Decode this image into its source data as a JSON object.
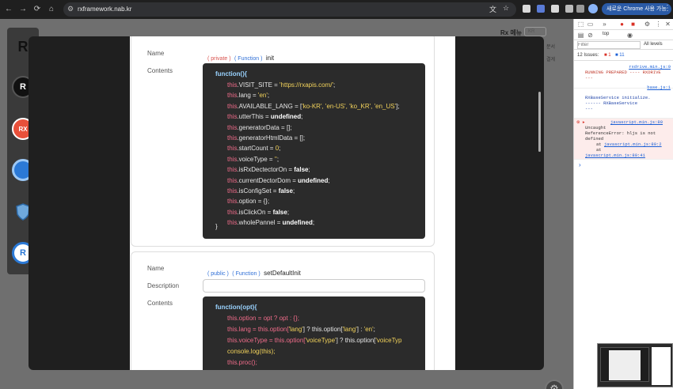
{
  "browser": {
    "url": "rxframework.nab.kr",
    "profile_label": "새로운 Chrome 사용 가능",
    "nav": {
      "back": "←",
      "forward": "→",
      "reload": "⟳",
      "home": "⌂"
    }
  },
  "page": {
    "rx_menu_label": "Rx 메뉴",
    "lang_value": "KR",
    "side_text_1": "분서",
    "side_text_2": "결게"
  },
  "dock": {
    "items": [
      {
        "icon": "rx-logo-icon",
        "text": "R"
      },
      {
        "icon": "rust-logo-icon",
        "text": "R"
      },
      {
        "icon": "rx-html-icon",
        "text": "RX"
      },
      {
        "icon": "blue-circle-icon",
        "text": ""
      },
      {
        "icon": "shield-icon",
        "text": ""
      },
      {
        "icon": "r-circle-icon",
        "text": ""
      }
    ]
  },
  "card1": {
    "name_label": "Name",
    "contents_label": "Contents",
    "access": "( private )",
    "kind": "( Function )",
    "func_name": "init"
  },
  "card2": {
    "name_label": "Name",
    "description_label": "Description",
    "contents_label": "Contents",
    "access": "( public )",
    "kind": "( Function )",
    "func_name": "setDefaultInit"
  },
  "code1": {
    "open": "function(){",
    "close": "}",
    "lines": [
      [
        "this",
        ".VISIT_SITE = ",
        "'https://rxapis.com/'",
        ";"
      ],
      [
        "this",
        ".lang = ",
        "'en'",
        ";"
      ],
      [
        "this",
        ".AVAILABLE_LANG = [",
        "'ko-KR', 'en-US', 'ko_KR', 'en_US'",
        "];"
      ],
      [
        "this",
        ".utterThis = ",
        "undefined",
        ";"
      ],
      [
        "this",
        ".generatorData = [];",
        "",
        ""
      ],
      [
        "this",
        ".generatorHtmlData = [];",
        "",
        ""
      ],
      [
        "this",
        ".startCount = ",
        "0",
        ";"
      ],
      [
        "this",
        ".voiceType = ",
        "''",
        ";"
      ],
      [
        "this",
        ".isRxDectectorOn = ",
        "false",
        ";"
      ],
      [
        "this",
        ".currentDectorDom = ",
        "undefined",
        ";"
      ],
      [
        "this",
        ".isConfigSet = ",
        "false",
        ";"
      ],
      [
        "this",
        ".option = {};",
        "",
        ""
      ],
      [
        "this",
        ".isClickOn = ",
        "false",
        ";"
      ],
      [
        "this",
        ".wholePannel = ",
        "undefined",
        ";"
      ]
    ]
  },
  "code2": {
    "open": "function(opt){",
    "close": "}",
    "line1": "this.option = opt ? opt : {};",
    "line2a": "this.lang = this.option[",
    "line2b": "'lang'",
    "line2c": "] ? this.option[",
    "line2d": "] : ",
    "line2e": "'en'",
    "line2f": ";",
    "line3a": "this.voiceType = this.option[",
    "line3b": "'voiceType'",
    "line3c": "] ? this.option[",
    "line3d": "'voiceTyp",
    "line4": "console.log(this);",
    "line5": "this.proc();"
  },
  "devtools": {
    "context": "top",
    "filter_placeholder": "Filter",
    "levels": "All levels",
    "issues_label": "12 Issues:",
    "issues_err": "1",
    "issues_info": "11",
    "m1_link": "rxdrive.min.js:9",
    "m1_text": "RUNNING PREPARED ---- RXDRIVE",
    "m1_tail": "---",
    "m2_link": "base.js:1",
    "m2_text": "RXBaseService initialize.",
    "m2_text2": "------ RXBaseService",
    "m2_tail": "---",
    "m3_link": "javascript.min.js:80",
    "m3_l1": "Uncaught",
    "m3_l2": "ReferenceError: hljs is not",
    "m3_l3": "defined",
    "m3_l4": "at",
    "m3_l4link": "javascript.min.js:80:2",
    "m3_l5": "at",
    "m3_l6link": "javascript.min.js:80:41",
    "prompt": "›"
  },
  "colors": {
    "accent": "#2f6fd6",
    "private": "#d9534f",
    "codebg": "#2b2b2b"
  }
}
